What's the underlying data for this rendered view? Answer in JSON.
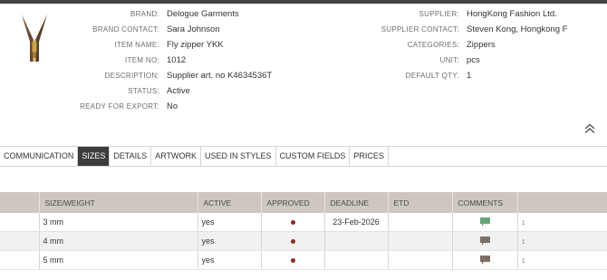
{
  "item": {
    "fields_left": [
      {
        "label": "BRAND:",
        "value": "Delogue Garments"
      },
      {
        "label": "BRAND CONTACT:",
        "value": "Sara Johnson"
      },
      {
        "label": "ITEM NAME:",
        "value": "Fly zipper YKK"
      },
      {
        "label": "ITEM NO:",
        "value": "1012"
      },
      {
        "label": "DESCRIPTION:",
        "value": "Supplier art. no K4634536T"
      },
      {
        "label": "STATUS:",
        "value": "Active"
      },
      {
        "label": "READY FOR EXPORT:",
        "value": "No"
      }
    ],
    "fields_right": [
      {
        "label": "SUPPLIER:",
        "value": "HongKong Fashion Ltd."
      },
      {
        "label": "SUPPLIER CONTACT:",
        "value": "Steven Kong, Hongkong F"
      },
      {
        "label": "CATEGORIES:",
        "value": "Zippers"
      },
      {
        "label": "UNIT:",
        "value": "pcs"
      },
      {
        "label": "DEFAULT QTY:",
        "value": "1"
      }
    ]
  },
  "tabs": [
    {
      "label": "COMMUNICATION",
      "active": false
    },
    {
      "label": "SIZES",
      "active": true
    },
    {
      "label": "DETAILS",
      "active": false
    },
    {
      "label": "ARTWORK",
      "active": false
    },
    {
      "label": "USED IN STYLES",
      "active": false
    },
    {
      "label": "CUSTOM FIELDS",
      "active": false
    },
    {
      "label": "PRICES",
      "active": false
    }
  ],
  "table": {
    "headers": [
      "",
      "SIZE/WEIGHT",
      "ACTIVE",
      "APPROVED",
      "DEADLINE",
      "ETD",
      "COMMENTS",
      ""
    ],
    "rows": [
      {
        "size": "3 mm",
        "active": "yes",
        "approved": true,
        "deadline": "23-Feb-2026",
        "etd": "",
        "comment_color": "#6aa57a"
      },
      {
        "size": "4 mm",
        "active": "yes",
        "approved": true,
        "deadline": "",
        "etd": "",
        "comment_color": "#7e6f68"
      },
      {
        "size": "5 mm",
        "active": "yes",
        "approved": true,
        "deadline": "",
        "etd": "",
        "comment_color": "#7e6f68"
      }
    ]
  },
  "icons": {
    "collapse": "chevron-double-up-icon",
    "thumbnail": "zipper-thumbnail",
    "comment": "comment-bubble-icon",
    "sort": "sort-arrows-icon"
  },
  "colors": {
    "active_tab": "#3c3c3c",
    "table_header": "#cdc7bf",
    "approved_dot": "#8b2e22"
  }
}
